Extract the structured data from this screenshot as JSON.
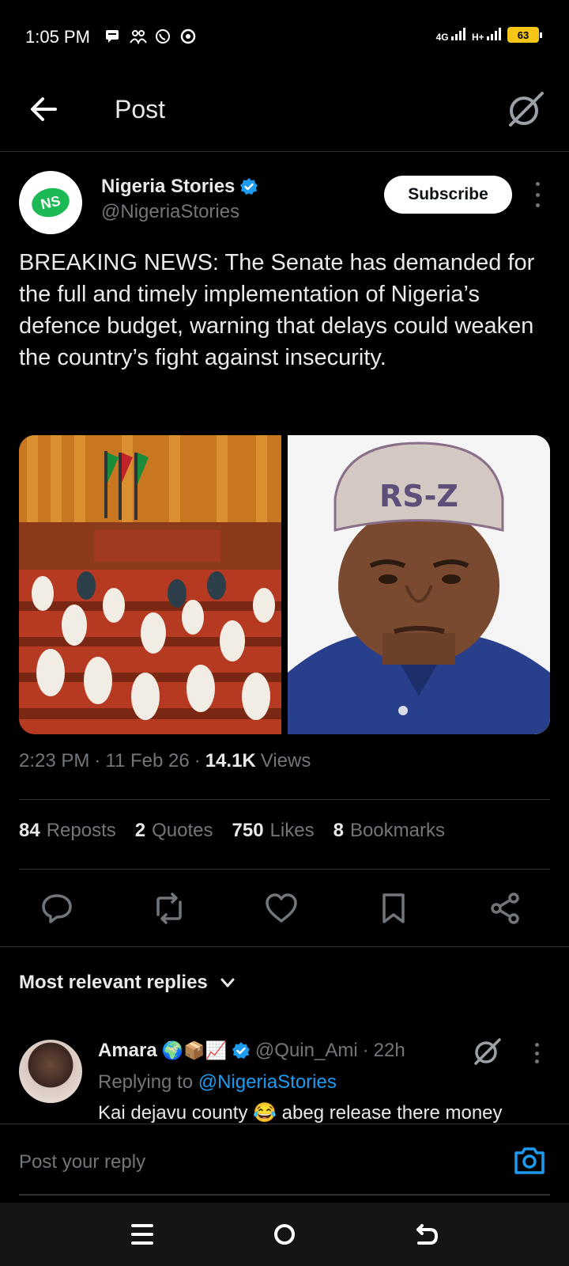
{
  "status_bar": {
    "time": "1:05 PM",
    "network_1": "4G",
    "network_2": "H+",
    "battery": "63"
  },
  "top_bar": {
    "title": "Post"
  },
  "post": {
    "author_name": "Nigeria Stories",
    "author_handle": "@NigeriaStories",
    "avatar_text": "NS",
    "subscribe_label": "Subscribe",
    "text": "BREAKING NEWS: The Senate has demanded for the full and timely implementation of Nigeria’s defence budget, warning that delays could weaken the country’s fight against insecurity.",
    "time": "2:23 PM",
    "separator": "·",
    "date": "11 Feb 26",
    "views_count": "14.1K",
    "views_label": "Views",
    "stats": [
      {
        "count": "84",
        "label": "Reposts"
      },
      {
        "count": "2",
        "label": "Quotes"
      },
      {
        "count": "750",
        "label": "Likes"
      },
      {
        "count": "8",
        "label": "Bookmarks"
      }
    ],
    "senator_cap_text": "RS-Z"
  },
  "replies": {
    "header": "Most relevant replies",
    "items": [
      {
        "name": "Amara",
        "emojis": "🌍📦📈",
        "handle": "@Quin_Ami",
        "age": "22h",
        "replying_prefix": "Replying to",
        "replying_to": "@NigeriaStories",
        "text": "Kai dejavu county 😂 abeg release there money"
      }
    ]
  },
  "compose": {
    "placeholder": "Post your reply"
  },
  "colors": {
    "accent": "#1d9bf0",
    "background": "#000000",
    "battery": "#f5c518"
  }
}
